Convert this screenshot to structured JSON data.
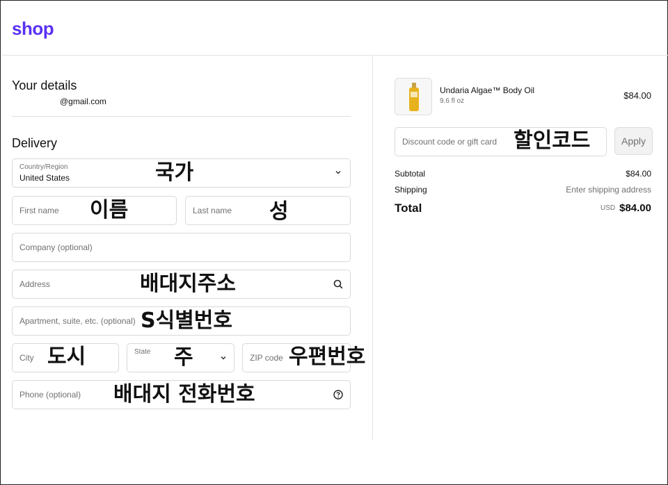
{
  "header": {
    "logo": "shop"
  },
  "details": {
    "title": "Your details",
    "email": "@gmail.com"
  },
  "delivery": {
    "title": "Delivery",
    "country": {
      "label": "Country/Region",
      "value": "United States",
      "annotation": "국가"
    },
    "first_name": {
      "placeholder": "First name",
      "annotation": "이름"
    },
    "last_name": {
      "placeholder": "Last name",
      "annotation": "성"
    },
    "company": {
      "placeholder": "Company (optional)"
    },
    "address": {
      "placeholder": "Address",
      "annotation": "배대지주소"
    },
    "apartment": {
      "placeholder": "Apartment, suite, etc. (optional)",
      "annotation": "S식별번호"
    },
    "city": {
      "placeholder": "City",
      "annotation": "도시"
    },
    "state": {
      "label": "State",
      "annotation": "주"
    },
    "zip": {
      "placeholder": "ZIP code",
      "annotation": "우편번호"
    },
    "phone": {
      "placeholder": "Phone (optional)",
      "annotation": "배대지 전화번호"
    }
  },
  "summary": {
    "product": {
      "name": "Undaria Algae™ Body Oil",
      "size": "9.6 fl oz",
      "price": "$84.00"
    },
    "discount": {
      "placeholder": "Discount code or gift card",
      "annotation": "할인코드",
      "apply_label": "Apply"
    },
    "subtotal": {
      "label": "Subtotal",
      "value": "$84.00"
    },
    "shipping": {
      "label": "Shipping",
      "value": "Enter shipping address"
    },
    "total": {
      "label": "Total",
      "currency": "USD",
      "value": "$84.00"
    }
  },
  "icons": {
    "search": "search-icon",
    "help": "question-circle-icon",
    "chevron": "chevron-down-icon",
    "accent_color": "#5a31f4"
  }
}
